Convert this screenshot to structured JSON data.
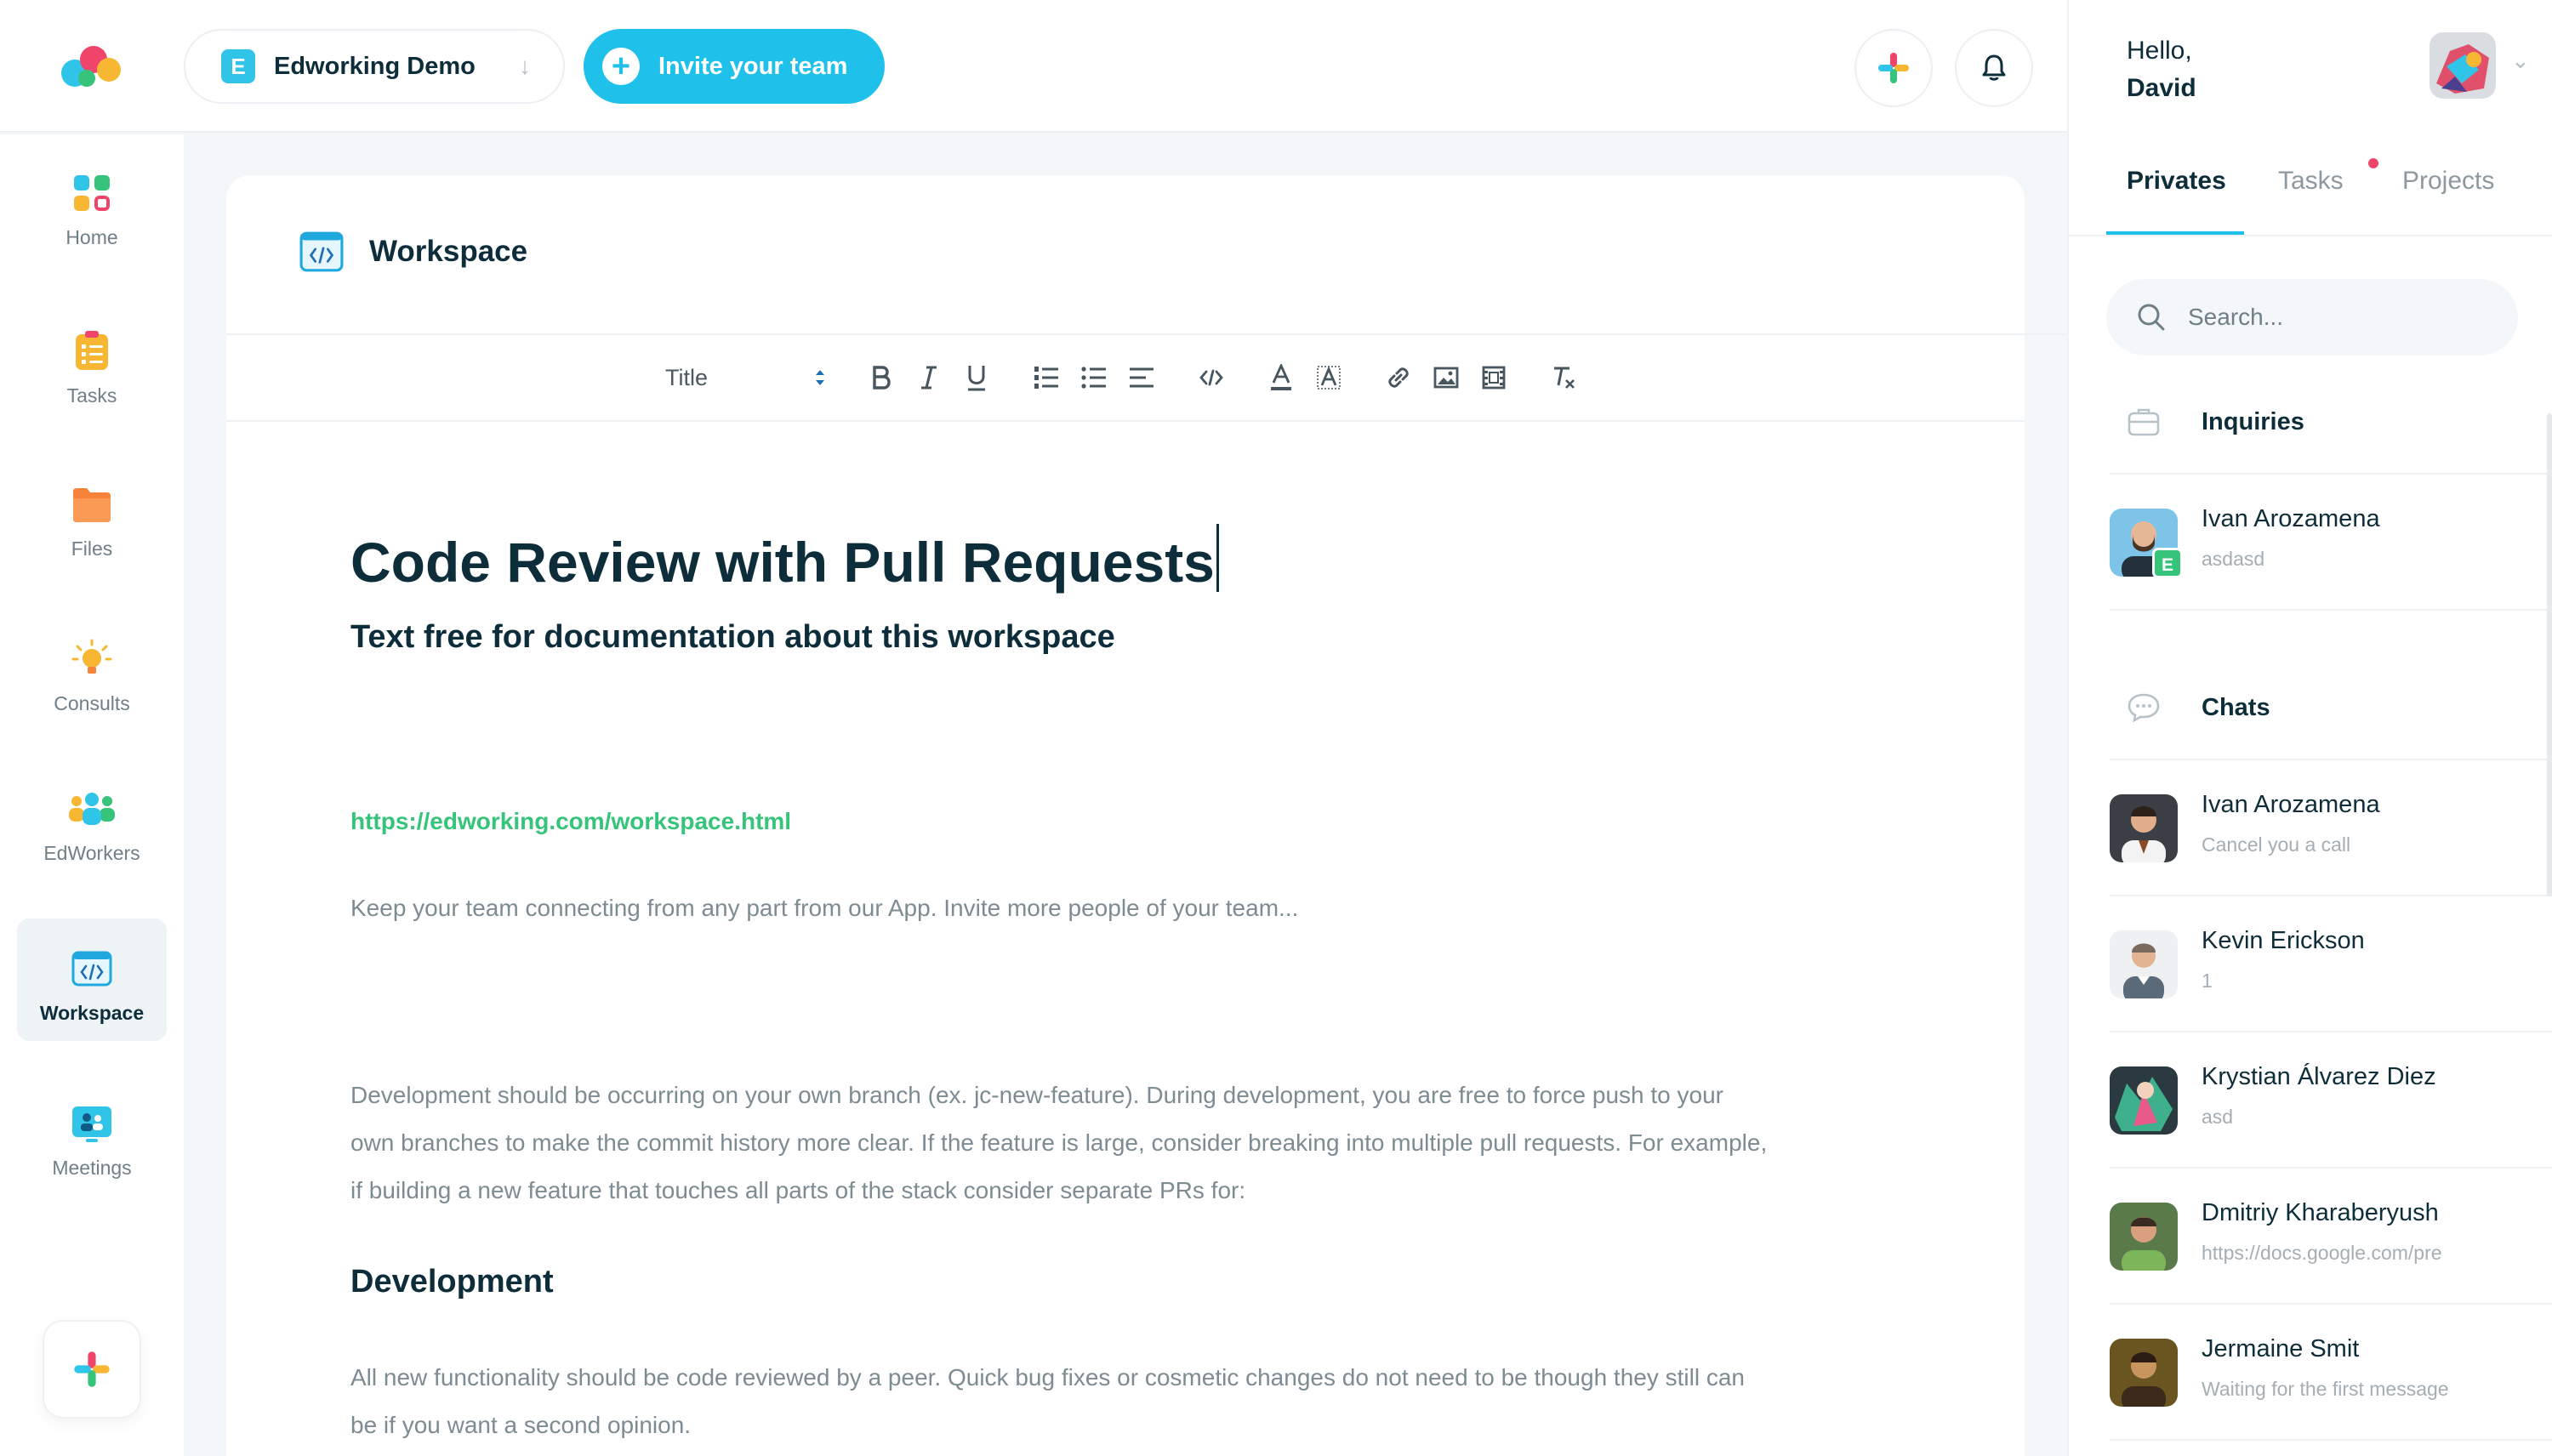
{
  "topbar": {
    "workspace_badge": "E",
    "workspace_name": "Edworking Demo",
    "workspace_arrow": "↓",
    "invite_label": "Invite your team"
  },
  "nav": {
    "items": [
      {
        "label": "Home",
        "icon": "home-icon"
      },
      {
        "label": "Tasks",
        "icon": "tasks-icon"
      },
      {
        "label": "Files",
        "icon": "folder-icon"
      },
      {
        "label": "Consults",
        "icon": "lightbulb-icon"
      },
      {
        "label": "EdWorkers",
        "icon": "people-icon"
      },
      {
        "label": "Workspace",
        "icon": "code-icon",
        "active": true
      },
      {
        "label": "Meetings",
        "icon": "meeting-icon"
      }
    ]
  },
  "editor": {
    "card_title": "Workspace",
    "toolbar": {
      "format_select": "Title"
    },
    "doc_title": "Code Review with Pull Requests",
    "doc_subtitle": "Text free for documentation about this workspace",
    "paragraph_1": "Keep your team connecting from any part from our App. Invite more people of your team...",
    "link": "https://edworking.com/workspace.html",
    "paragraph_2_line_1": "Development should be occurring on your own branch (ex. jc-new-feature). During development, you are free to force push to your",
    "paragraph_2_line_2": "own branches to make the commit history more clear. If the feature is large, consider breaking into multiple pull requests. For example,",
    "paragraph_2_line_3": "if building a new feature that touches all parts of the stack consider separate PRs for:",
    "heading_2": "Development",
    "paragraph_3_line_1": "All new functionality should be code reviewed by a peer. Quick bug fixes or cosmetic changes do not need to be though they still can",
    "paragraph_3_line_2": "be if you want a second opinion."
  },
  "rightpanel": {
    "greeting": "Hello,",
    "user_name": "David",
    "tabs": [
      "Privates",
      "Tasks",
      "Projects"
    ],
    "search_placeholder": "Search...",
    "inquiries_title": "Inquiries",
    "inquiries": [
      {
        "name": "Ivan Arozamena",
        "sub": "asdasd",
        "badge": "E"
      }
    ],
    "chats_title": "Chats",
    "chats": [
      {
        "name": "Ivan Arozamena",
        "sub": "Cancel you a call"
      },
      {
        "name": "Kevin Erickson",
        "sub": "1"
      },
      {
        "name": "Krystian Álvarez Diez",
        "sub": "asd"
      },
      {
        "name": "Dmitriy Kharaberyush",
        "sub": "https://docs.google.com/pre"
      },
      {
        "name": "Jermaine Smit",
        "sub": "Waiting for the first message"
      }
    ]
  },
  "colors": {
    "accent": "#1fc1eb",
    "link_green": "#36c47a",
    "dark_text": "#0e2d3a",
    "muted_text": "#7d8b93",
    "notification_dot": "#f0456b"
  }
}
